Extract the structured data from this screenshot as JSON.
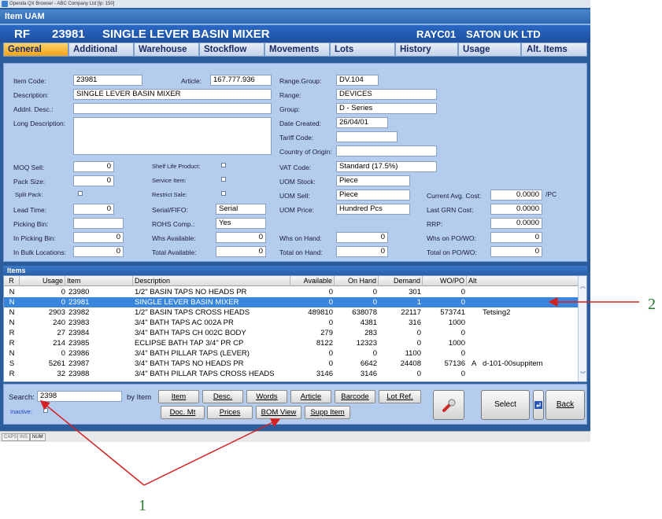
{
  "window": {
    "title": "Openda QX Browser  -  ABC Company Ltd [Ip: 150]"
  },
  "app": {
    "section_title": "Item UAM"
  },
  "item_header": {
    "type": "RF",
    "code": "23981",
    "name": "SINGLE LEVER BASIN MIXER",
    "customer_code": "RAYC01",
    "customer_name": "SATON UK LTD"
  },
  "tabs": [
    "General",
    "Additional",
    "Warehouse",
    "Stockflow",
    "Movements",
    "Lots",
    "History",
    "Usage",
    "Alt. Items"
  ],
  "form": {
    "item_code_label": "Item Code:",
    "item_code": "23981",
    "article_label": "Article:",
    "article": "167.777.936",
    "description_label": "Description:",
    "description": "SINGLE LEVER BASIN MIXER",
    "addnl_desc_label": "Addnl. Desc.:",
    "addnl_desc": "",
    "long_desc_label": "Long Description:",
    "long_desc": "",
    "range_group_label": "Range.Group:",
    "range_group": "DV.104",
    "range_label": "Range:",
    "range": "DEVICES",
    "group_label": "Group:",
    "group": "D - Series",
    "date_created_label": "Date Created:",
    "date_created": "26/04/01",
    "tariff_code_label": "Tariff Code:",
    "tariff_code": "",
    "country_label": "Country of Origin:",
    "country": "",
    "moq_sell_label": "MOQ Sell:",
    "moq_sell": "0",
    "pack_size_label": "Pack Size:",
    "pack_size": "0",
    "split_pack_label": "Split Pack:",
    "lead_time_label": "Lead Time:",
    "lead_time": "0",
    "picking_bin_label": "Picking Bin:",
    "picking_bin": "",
    "in_picking_bin_label": "In Picking Bin:",
    "in_picking_bin": "0",
    "in_bulk_label": "In Bulk Locations:",
    "in_bulk": "0",
    "shelf_life_label": "Shelf Life Product:",
    "service_item_label": "Service Item:",
    "restrict_sale_label": "Restrict Sale:",
    "serial_fifo_label": "Serial/FIFO:",
    "serial_fifo": "Serial",
    "rohs_label": "ROHS Comp.:",
    "rohs": "Yes",
    "whs_available_label": "Whs Available:",
    "whs_available": "0",
    "total_available_label": "Total Available:",
    "total_available": "0",
    "vat_code_label": "VAT Code:",
    "vat_code": "Standard (17.5%)",
    "uom_stock_label": "UOM Stock:",
    "uom_stock": "Piece",
    "uom_sell_label": "UOM Sell:",
    "uom_sell": "Piece",
    "uom_price_label": "UOM Price:",
    "uom_price": "Hundred Pcs",
    "whs_on_hand_label": "Whs on Hand:",
    "whs_on_hand": "0",
    "total_on_hand_label": "Total on Hand:",
    "total_on_hand": "0",
    "current_avg_cost_label": "Current Avg. Cost:",
    "current_avg_cost": "0.0000",
    "per_pc": "/PC",
    "last_grn_cost_label": "Last GRN Cost:",
    "last_grn_cost": "0.0000",
    "rrp_label": "RRP:",
    "rrp": "0.0000",
    "whs_on_po_label": "Whs on PO/WO:",
    "whs_on_po": "0",
    "total_on_po_label": "Total on PO/WO:",
    "total_on_po": "0"
  },
  "items_section": {
    "title": "Items"
  },
  "grid": {
    "headers": [
      "R",
      "Usage",
      "Item",
      "Description",
      "Available",
      "On Hand",
      "Demand",
      "WO/PO",
      "Alt"
    ],
    "rows": [
      {
        "r": "N",
        "usage": "0",
        "item": "23980",
        "desc": "1/2\" BASIN TAPS NO HEADS PR",
        "available": "0",
        "onhand": "0",
        "demand": "301",
        "wopo": "0",
        "alt": "",
        "extra": ""
      },
      {
        "r": "N",
        "usage": "0",
        "item": "23981",
        "desc": "SINGLE LEVER BASIN MIXER",
        "available": "0",
        "onhand": "0",
        "demand": "1",
        "wopo": "0",
        "alt": "",
        "extra": ""
      },
      {
        "r": "N",
        "usage": "2903",
        "item": "23982",
        "desc": "1/2\" BASIN TAPS CROSS HEADS",
        "available": "489810",
        "onhand": "638078",
        "demand": "22117",
        "wopo": "573741",
        "alt": "",
        "extra": "Tetsing2"
      },
      {
        "r": "N",
        "usage": "240",
        "item": "23983",
        "desc": "3/4\" BATH TAPS AC 002A PR",
        "available": "0",
        "onhand": "4381",
        "demand": "316",
        "wopo": "1000",
        "alt": "",
        "extra": ""
      },
      {
        "r": "R",
        "usage": "27",
        "item": "23984",
        "desc": "3/4\" BATH TAPS CH 002C BODY",
        "available": "279",
        "onhand": "283",
        "demand": "0",
        "wopo": "0",
        "alt": "",
        "extra": ""
      },
      {
        "r": "R",
        "usage": "214",
        "item": "23985",
        "desc": "ECLIPSE BATH TAP 3/4\" PR CP",
        "available": "8122",
        "onhand": "12323",
        "demand": "0",
        "wopo": "1000",
        "alt": "",
        "extra": ""
      },
      {
        "r": "N",
        "usage": "0",
        "item": "23986",
        "desc": "3/4\" BATH PILLAR TAPS (LEVER)",
        "available": "0",
        "onhand": "0",
        "demand": "1100",
        "wopo": "0",
        "alt": "",
        "extra": ""
      },
      {
        "r": "S",
        "usage": "5261",
        "item": "23987",
        "desc": "3/4\" BATH TAPS NO HEADS PR",
        "available": "0",
        "onhand": "6642",
        "demand": "24408",
        "wopo": "57136",
        "alt": "A",
        "extra": "d-101-00suppitem"
      },
      {
        "r": "R",
        "usage": "32",
        "item": "23988",
        "desc": "3/4\" BATH PILLAR TAPS CROSS HEADS",
        "available": "3146",
        "onhand": "3146",
        "demand": "0",
        "wopo": "0",
        "alt": "",
        "extra": ""
      }
    ],
    "selected_index": 1
  },
  "search": {
    "label": "Search:",
    "value": "2398",
    "by_label": "by Item",
    "inactive_label": "Inactive:"
  },
  "buttons": {
    "item": "Item",
    "desc": "Desc.",
    "words": "Words",
    "article": "Article",
    "barcode": "Barcode",
    "lot_ref": "Lot Ref.",
    "doc_mt": "Doc. Mt",
    "prices": "Prices",
    "bom_view": "BOM View",
    "supp_item": "Supp Item",
    "select": "Select",
    "back": "Back"
  },
  "status": [
    "CAPS",
    "INS",
    "NUM"
  ],
  "callouts": {
    "one": "1",
    "two": "2"
  },
  "colors": {
    "accent": "#2a68c4",
    "tab_active": "#f3a21a",
    "selection": "#3a86dc",
    "arrow": "#d42020",
    "callout": "#2a7a2a"
  }
}
